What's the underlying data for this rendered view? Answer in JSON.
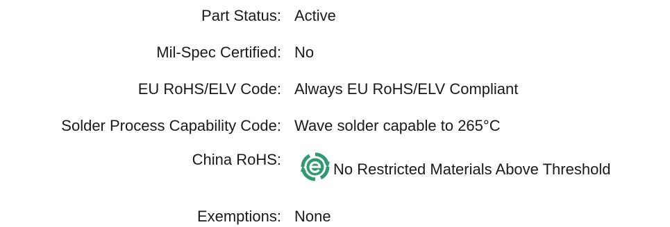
{
  "specs": {
    "part_status": {
      "label": "Part Status:",
      "value": "Active"
    },
    "mil_spec": {
      "label": "Mil-Spec Certified:",
      "value": "No"
    },
    "eu_rohs": {
      "label": "EU RoHS/ELV Code:",
      "value": "Always EU RoHS/ELV Compliant"
    },
    "solder_process": {
      "label": "Solder Process Capability Code:",
      "value": "Wave solder capable to 265°C"
    },
    "china_rohs": {
      "label": "China RoHS:",
      "value": "No Restricted Materials Above Threshold",
      "icon": "china-rohs-green-e-icon",
      "icon_color": "#2e9b6e"
    },
    "exemptions": {
      "label": "Exemptions:",
      "value": "None"
    }
  }
}
